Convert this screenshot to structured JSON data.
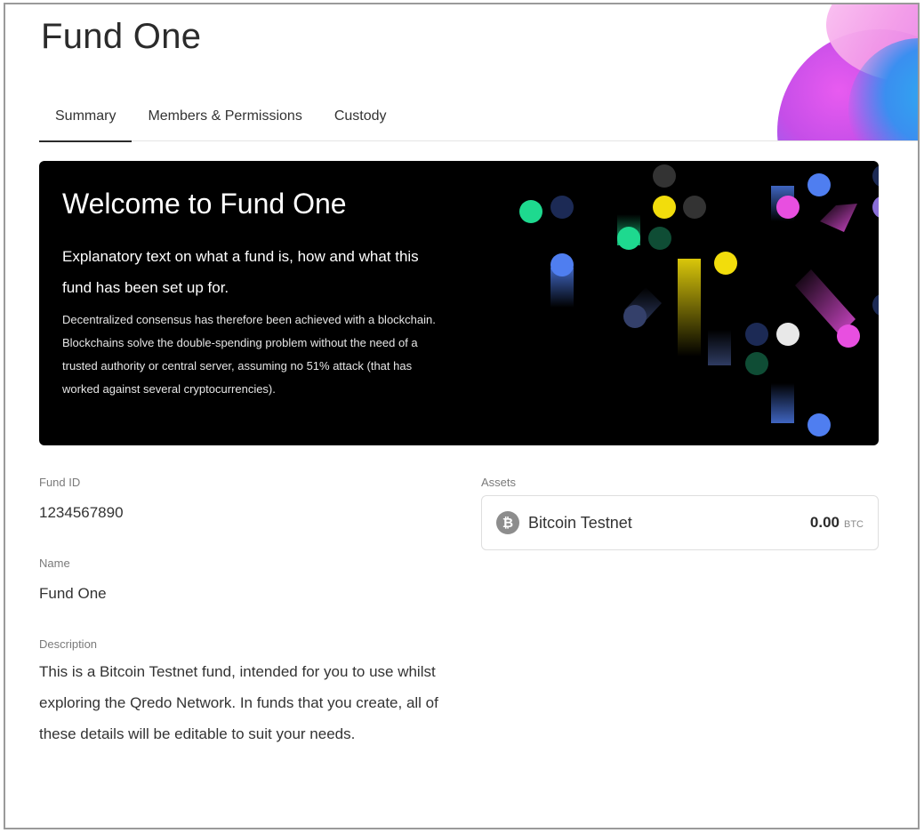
{
  "page": {
    "title": "Fund One"
  },
  "tabs": [
    {
      "label": "Summary",
      "active": true
    },
    {
      "label": "Members & Permissions",
      "active": false
    },
    {
      "label": "Custody",
      "active": false
    }
  ],
  "banner": {
    "heading": "Welcome to Fund One",
    "lead": "Explanatory text on what a fund is, how and what this fund has been set up for.",
    "body": "Decentralized consensus has therefore been achieved with a blockchain. Blockchains solve the double-spending problem without the need of a trusted authority or central server, assuming no 51% attack (that has worked against several cryptocurrencies)."
  },
  "details": {
    "fund_id_label": "Fund ID",
    "fund_id_value": "1234567890",
    "name_label": "Name",
    "name_value": "Fund One",
    "description_label": "Description",
    "description_value": "This is a Bitcoin Testnet fund, intended for you to use whilst exploring the Qredo Network. In funds that you create, all of these details will be editable to suit your needs."
  },
  "assets": {
    "label": "Assets",
    "items": [
      {
        "icon": "bitcoin-icon",
        "icon_glyph": "₿",
        "name": "Bitcoin Testnet",
        "amount": "0.00",
        "unit": "BTC"
      }
    ]
  },
  "colors": {
    "banner_bg": "#000000",
    "dot_green": "#1ed98f",
    "dot_yellow": "#f2dd0c",
    "dot_blue": "#4f7ef0",
    "dot_magenta": "#e84fe0",
    "dot_navy": "#1c2a55"
  }
}
